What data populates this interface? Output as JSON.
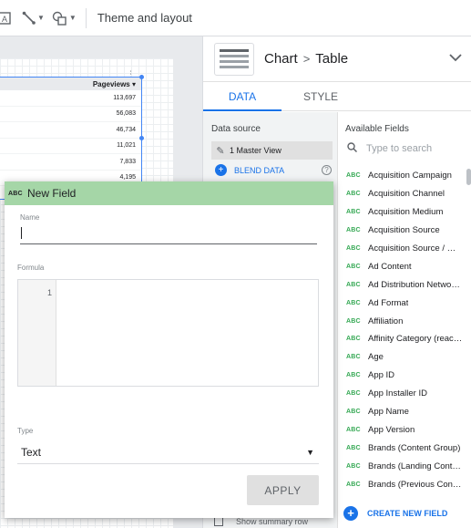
{
  "toolbar": {
    "theme_label": "Theme and layout"
  },
  "table": {
    "header": "Pageviews ▾",
    "rows": [
      "113,697",
      "56,083",
      "46,734",
      "11,021",
      "7,833",
      "4,195"
    ]
  },
  "panel": {
    "breadcrumb_chart": "Chart",
    "breadcrumb_table": "Table",
    "tabs": {
      "data": "DATA",
      "style": "STYLE"
    },
    "data_source": {
      "title": "Data source",
      "source_name": "1 Master View",
      "blend_label": "BLEND DATA"
    },
    "summary_label": "Show summary row",
    "available_fields": {
      "title": "Available Fields",
      "search_placeholder": "Type to search",
      "type_badge": "ABC",
      "items": [
        "Acquisition Campaign",
        "Acquisition Channel",
        "Acquisition Medium",
        "Acquisition Source",
        "Acquisition Source / …",
        "Ad Content",
        "Ad Distribution Netwo…",
        "Ad Format",
        "Affiliation",
        "Affinity Category (reac…",
        "Age",
        "App ID",
        "App Installer ID",
        "App Name",
        "App Version",
        "Brands (Content Group)",
        "Brands (Landing Cont…",
        "Brands (Previous Con…"
      ],
      "create_label": "CREATE NEW FIELD"
    }
  },
  "dialog": {
    "title": "New Field",
    "type_badge": "ABC",
    "name_label": "Name",
    "name_value": "",
    "formula_label": "Formula",
    "line_number": "1",
    "type_label": "Type",
    "type_value": "Text",
    "apply_label": "APPLY"
  }
}
